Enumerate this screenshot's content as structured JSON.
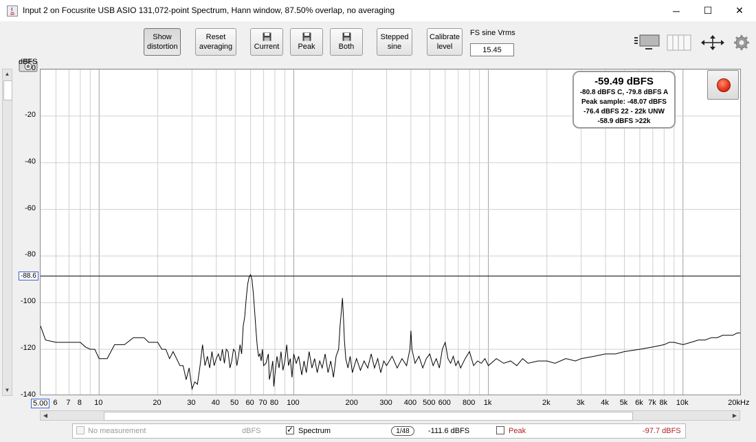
{
  "window": {
    "title": "Input 2 on Focusrite USB ASIO 131,072-point Spectrum, Hann window, 87.50% overlap, no averaging",
    "controls": [
      "─",
      "☐",
      "✕"
    ]
  },
  "toolbar": {
    "show_distortion": "Show distortion",
    "reset_averaging": "Reset averaging",
    "current": "Current",
    "peak": "Peak",
    "both": "Both",
    "stepped_sine": "Stepped sine",
    "calibrate_level": "Calibrate level",
    "fs_label": "FS sine Vrms",
    "fs_value": "15.45"
  },
  "plot": {
    "y_unit": "dBFS",
    "cursor_value": "-88.6",
    "info": {
      "main": "-59.49 dBFS",
      "lines": [
        "-80.8 dBFS C, -79.8 dBFS A",
        "Peak sample: -48.07 dBFS",
        "-76.4 dBFS 22 - 22k UNW",
        "-58.9 dBFS >22k"
      ]
    }
  },
  "chart_data": {
    "type": "line",
    "title": "",
    "xlabel": "",
    "ylabel": "dBFS",
    "x_scale": "log",
    "xlim": [
      5,
      20000
    ],
    "ylim": [
      -140,
      0
    ],
    "y_ticks": [
      {
        "value": 0,
        "label": "0"
      },
      {
        "value": -20,
        "label": "-20"
      },
      {
        "value": -40,
        "label": "-40"
      },
      {
        "value": -60,
        "label": "-60"
      },
      {
        "value": -80,
        "label": "-80"
      },
      {
        "value": -100,
        "label": "-100"
      },
      {
        "value": -120,
        "label": "-120"
      },
      {
        "value": -140,
        "label": "-140"
      }
    ],
    "x_ticks": [
      {
        "value": 6,
        "label": "6"
      },
      {
        "value": 7,
        "label": "7"
      },
      {
        "value": 8,
        "label": "8"
      },
      {
        "value": 10,
        "label": "10"
      },
      {
        "value": 20,
        "label": "20"
      },
      {
        "value": 30,
        "label": "30"
      },
      {
        "value": 40,
        "label": "40"
      },
      {
        "value": 50,
        "label": "50"
      },
      {
        "value": 60,
        "label": "60"
      },
      {
        "value": 70,
        "label": "70"
      },
      {
        "value": 80,
        "label": "80"
      },
      {
        "value": 100,
        "label": "100"
      },
      {
        "value": 200,
        "label": "200"
      },
      {
        "value": 300,
        "label": "300"
      },
      {
        "value": 400,
        "label": "400"
      },
      {
        "value": 500,
        "label": "500"
      },
      {
        "value": 600,
        "label": "600"
      },
      {
        "value": 800,
        "label": "800"
      },
      {
        "value": 1000,
        "label": "1k"
      },
      {
        "value": 2000,
        "label": "2k"
      },
      {
        "value": 3000,
        "label": "3k"
      },
      {
        "value": 4000,
        "label": "4k"
      },
      {
        "value": 5000,
        "label": "5k"
      },
      {
        "value": 6000,
        "label": "6k"
      },
      {
        "value": 7000,
        "label": "7k"
      },
      {
        "value": 8000,
        "label": "8k"
      },
      {
        "value": 10000,
        "label": "10k"
      },
      {
        "value": 20000,
        "label": "20kHz"
      }
    ],
    "x_start_label": "5.00",
    "cursor_level": -88.6,
    "series": [
      {
        "name": "Spectrum",
        "color": "#000000",
        "points": [
          [
            5,
            -110
          ],
          [
            5.3,
            -116
          ],
          [
            6,
            -117
          ],
          [
            8,
            -117
          ],
          [
            8.5,
            -119
          ],
          [
            9,
            -120
          ],
          [
            9.5,
            -120
          ],
          [
            10,
            -124
          ],
          [
            11,
            -124
          ],
          [
            12,
            -118
          ],
          [
            13.5,
            -118
          ],
          [
            15,
            -115
          ],
          [
            17,
            -115
          ],
          [
            18,
            -117
          ],
          [
            20,
            -117
          ],
          [
            21,
            -120
          ],
          [
            22,
            -120
          ],
          [
            23,
            -124
          ],
          [
            24,
            -121
          ],
          [
            25,
            -124
          ],
          [
            26,
            -127
          ],
          [
            27,
            -127
          ],
          [
            28,
            -133
          ],
          [
            29,
            -128
          ],
          [
            30,
            -137
          ],
          [
            31,
            -134
          ],
          [
            32,
            -135
          ],
          [
            33,
            -127
          ],
          [
            34,
            -118
          ],
          [
            35,
            -127
          ],
          [
            36,
            -123
          ],
          [
            37,
            -128
          ],
          [
            38,
            -121
          ],
          [
            39,
            -127
          ],
          [
            40,
            -124
          ],
          [
            41,
            -122
          ],
          [
            42,
            -125
          ],
          [
            43,
            -120
          ],
          [
            44,
            -126
          ],
          [
            45,
            -120
          ],
          [
            46,
            -121
          ],
          [
            47,
            -128
          ],
          [
            48,
            -125
          ],
          [
            49,
            -120
          ],
          [
            50,
            -121
          ],
          [
            51,
            -127
          ],
          [
            52,
            -123
          ],
          [
            53,
            -118
          ],
          [
            54,
            -122
          ],
          [
            55,
            -110
          ],
          [
            56,
            -106
          ],
          [
            57,
            -98
          ],
          [
            58,
            -92
          ],
          [
            59,
            -89
          ],
          [
            60,
            -88
          ],
          [
            61,
            -90
          ],
          [
            62,
            -96
          ],
          [
            63,
            -104
          ],
          [
            64,
            -112
          ],
          [
            65,
            -119
          ],
          [
            66,
            -123
          ],
          [
            67,
            -122
          ],
          [
            68,
            -125
          ],
          [
            69,
            -120
          ],
          [
            70,
            -127
          ],
          [
            72,
            -126
          ],
          [
            74,
            -122
          ],
          [
            75,
            -133
          ],
          [
            77,
            -128
          ],
          [
            78,
            -125
          ],
          [
            79,
            -136
          ],
          [
            80,
            -131
          ],
          [
            82,
            -123
          ],
          [
            84,
            -128
          ],
          [
            86,
            -121
          ],
          [
            88,
            -129
          ],
          [
            90,
            -125
          ],
          [
            92,
            -118
          ],
          [
            94,
            -127
          ],
          [
            96,
            -124
          ],
          [
            98,
            -132
          ],
          [
            100,
            -122
          ],
          [
            103,
            -126
          ],
          [
            106,
            -123
          ],
          [
            110,
            -131
          ],
          [
            113,
            -125
          ],
          [
            116,
            -130
          ],
          [
            120,
            -121
          ],
          [
            124,
            -128
          ],
          [
            128,
            -124
          ],
          [
            132,
            -130
          ],
          [
            136,
            -125
          ],
          [
            140,
            -128
          ],
          [
            145,
            -122
          ],
          [
            150,
            -130
          ],
          [
            155,
            -125
          ],
          [
            160,
            -132
          ],
          [
            165,
            -123
          ],
          [
            170,
            -120
          ],
          [
            173,
            -110
          ],
          [
            176,
            -103
          ],
          [
            178,
            -98
          ],
          [
            180,
            -106
          ],
          [
            182,
            -116
          ],
          [
            185,
            -124
          ],
          [
            190,
            -128
          ],
          [
            195,
            -123
          ],
          [
            200,
            -130
          ],
          [
            210,
            -124
          ],
          [
            220,
            -129
          ],
          [
            230,
            -125
          ],
          [
            240,
            -128
          ],
          [
            250,
            -122
          ],
          [
            260,
            -128
          ],
          [
            270,
            -124
          ],
          [
            280,
            -130
          ],
          [
            290,
            -125
          ],
          [
            300,
            -127
          ],
          [
            320,
            -123
          ],
          [
            340,
            -128
          ],
          [
            360,
            -124
          ],
          [
            380,
            -127
          ],
          [
            395,
            -120
          ],
          [
            400,
            -112
          ],
          [
            405,
            -120
          ],
          [
            420,
            -126
          ],
          [
            440,
            -123
          ],
          [
            460,
            -128
          ],
          [
            480,
            -124
          ],
          [
            500,
            -122
          ],
          [
            520,
            -127
          ],
          [
            540,
            -124
          ],
          [
            560,
            -128
          ],
          [
            580,
            -120
          ],
          [
            600,
            -117
          ],
          [
            620,
            -124
          ],
          [
            640,
            -126
          ],
          [
            660,
            -123
          ],
          [
            680,
            -127
          ],
          [
            700,
            -125
          ],
          [
            720,
            -128
          ],
          [
            760,
            -124
          ],
          [
            800,
            -121
          ],
          [
            840,
            -127
          ],
          [
            880,
            -125
          ],
          [
            920,
            -126
          ],
          [
            960,
            -124
          ],
          [
            1000,
            -127
          ],
          [
            1100,
            -124
          ],
          [
            1200,
            -126
          ],
          [
            1300,
            -125
          ],
          [
            1400,
            -127
          ],
          [
            1500,
            -124
          ],
          [
            1600,
            -126
          ],
          [
            1800,
            -125
          ],
          [
            2000,
            -125
          ],
          [
            2200,
            -126
          ],
          [
            2500,
            -124
          ],
          [
            2800,
            -125
          ],
          [
            3000,
            -124
          ],
          [
            3500,
            -123
          ],
          [
            4000,
            -122
          ],
          [
            4500,
            -122
          ],
          [
            5000,
            -121
          ],
          [
            6000,
            -120
          ],
          [
            7000,
            -119
          ],
          [
            8000,
            -118
          ],
          [
            8500,
            -117
          ],
          [
            9000,
            -117
          ],
          [
            10000,
            -118
          ],
          [
            11000,
            -117
          ],
          [
            12000,
            -116
          ],
          [
            13000,
            -116
          ],
          [
            14000,
            -115
          ],
          [
            15000,
            -115
          ],
          [
            16000,
            -114
          ],
          [
            17000,
            -114
          ],
          [
            18000,
            -114
          ],
          [
            19000,
            -113
          ],
          [
            20000,
            -113
          ]
        ]
      }
    ]
  },
  "statusbar": {
    "no_measurement": "No measurement",
    "no_measurement_unit": "dBFS",
    "spectrum_label": "Spectrum",
    "smoothing": "1/48",
    "spectrum_value": "-111.6 dBFS",
    "peak_label": "Peak",
    "peak_value": "-97.7 dBFS",
    "peak_color": "#b22222"
  }
}
